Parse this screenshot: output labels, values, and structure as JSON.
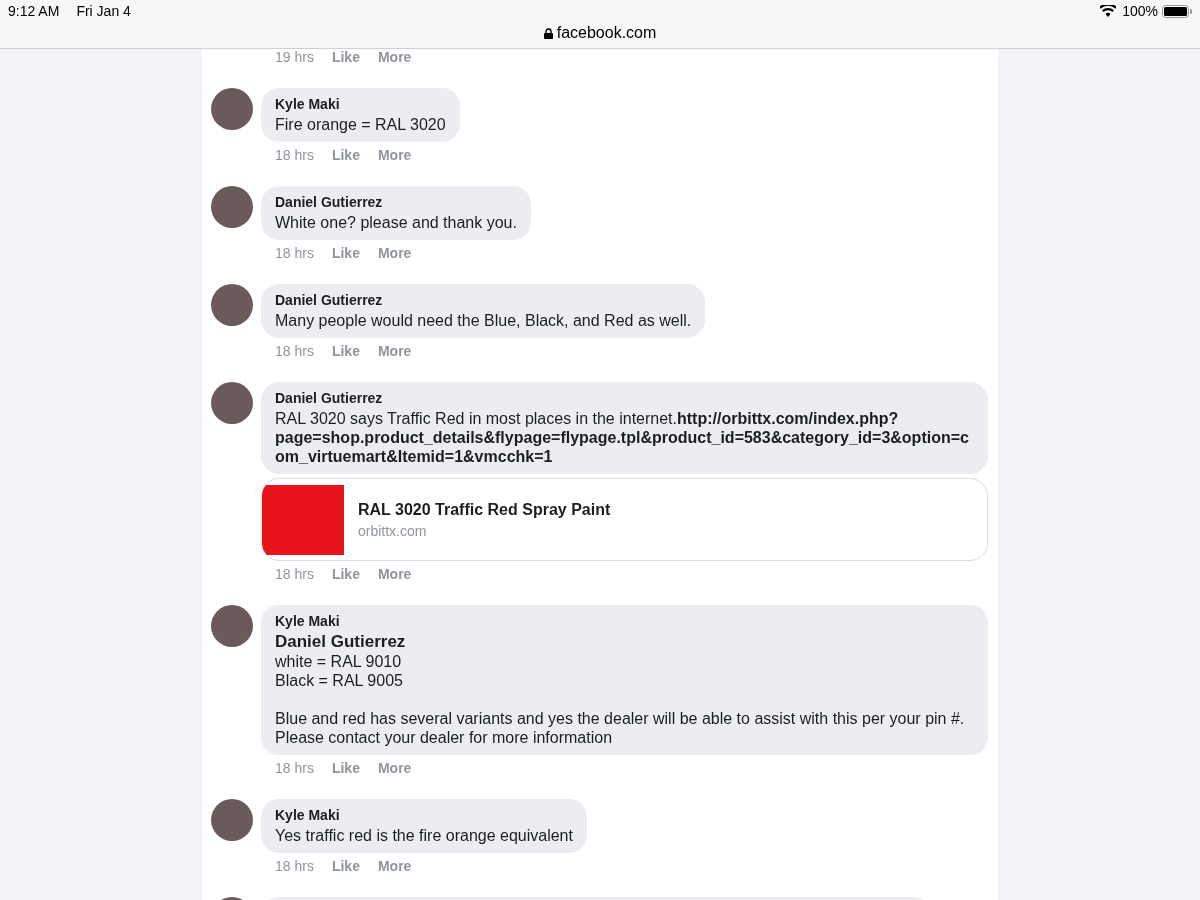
{
  "status_bar": {
    "time": "9:12 AM",
    "date": "Fri Jan 4",
    "battery": "100%"
  },
  "address_bar": {
    "domain": "facebook.com"
  },
  "top_meta": {
    "time": "19 hrs",
    "actions": [
      "Like",
      "More"
    ]
  },
  "comments": [
    {
      "author": "Kyle Maki",
      "paragraphs": [
        {
          "kind": "text",
          "text": "Fire orange = RAL 3020"
        }
      ],
      "time": "18 hrs",
      "actions": [
        "Like",
        "More"
      ]
    },
    {
      "author": "Daniel Gutierrez",
      "paragraphs": [
        {
          "kind": "text",
          "text": "White one? please and thank you."
        }
      ],
      "time": "18 hrs",
      "actions": [
        "Like",
        "More"
      ]
    },
    {
      "author": "Daniel Gutierrez",
      "paragraphs": [
        {
          "kind": "text",
          "text": "Many people would need the Blue, Black, and Red as well."
        }
      ],
      "time": "18 hrs",
      "actions": [
        "Like",
        "More"
      ]
    },
    {
      "author": "Daniel Gutierrez",
      "paragraphs": [
        {
          "kind": "text",
          "text": "RAL 3020 says Traffic Red in most places in the internet.**http://orbittx.com/index.php?page=shop.product_details&flypage=flypage.tpl&product_id=583&category_id=3&option=com_virtuemart&Itemid=1&vmcchk=1**"
        }
      ],
      "link_preview": {
        "title": "RAL 3020 Traffic Red Spray Paint",
        "domain": "orbittx.com"
      },
      "time": "18 hrs",
      "actions": [
        "Like",
        "More"
      ]
    },
    {
      "author": "Kyle Maki",
      "paragraphs": [
        {
          "kind": "mention",
          "text": "Daniel Gutierrez"
        },
        {
          "kind": "text",
          "text": "white = RAL 9010\nBlack = RAL 9005"
        },
        {
          "kind": "text",
          "text": "Blue and red has several variants and yes the dealer will be able to assist with this per your pin #. Please contact your dealer for more information"
        }
      ],
      "time": "18 hrs",
      "actions": [
        "Like",
        "More"
      ]
    },
    {
      "author": "Kyle Maki",
      "paragraphs": [
        {
          "kind": "text",
          "text": "Yes traffic red is the fire orange equivalent"
        }
      ],
      "time": "18 hrs",
      "actions": [
        "Like",
        "More"
      ]
    }
  ]
}
